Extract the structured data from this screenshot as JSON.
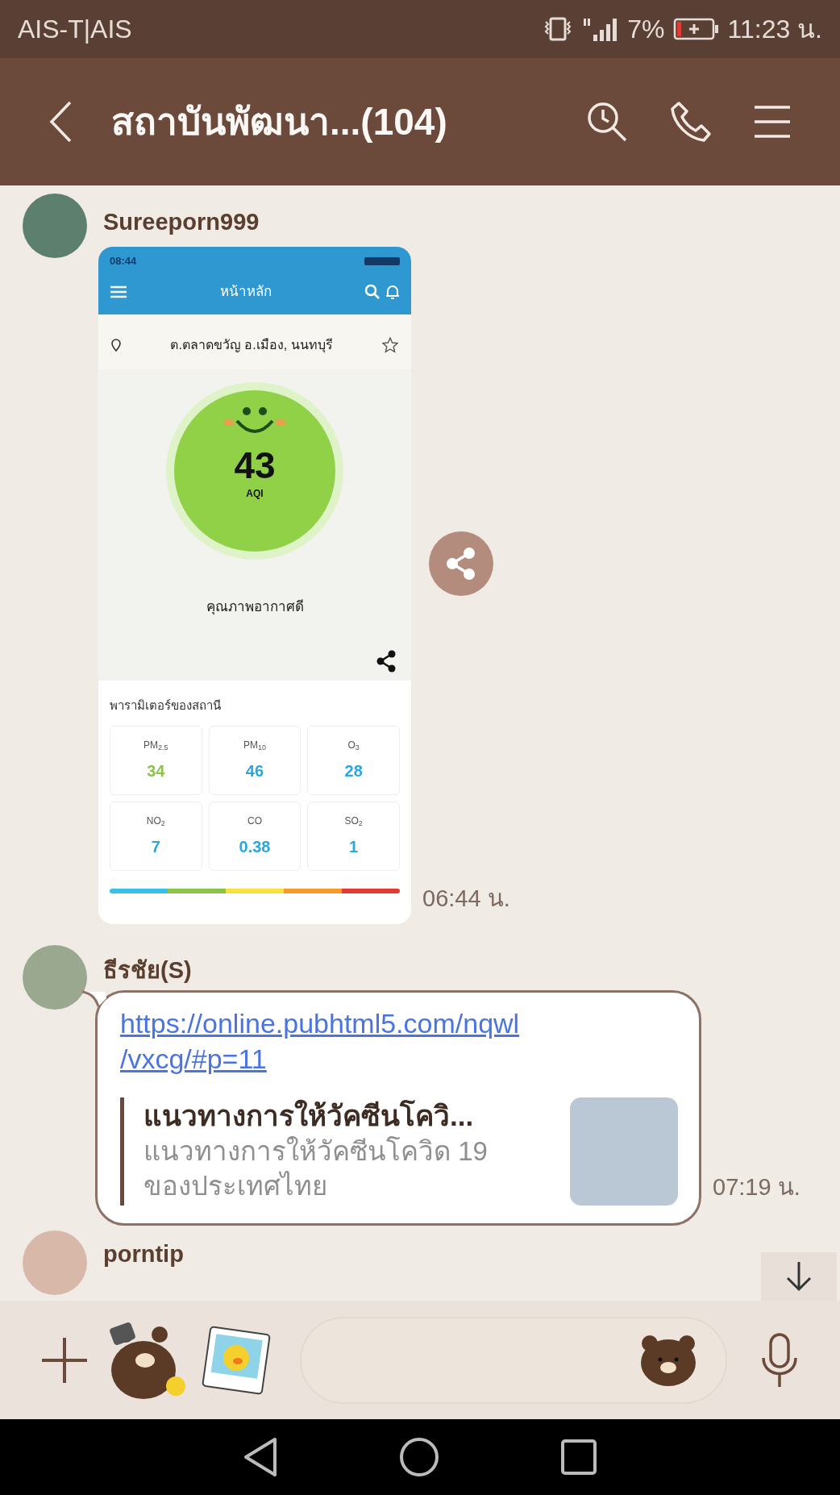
{
  "status_bar": {
    "carrier": "AIS-T|AIS",
    "battery_percent": "7%",
    "time": "11:23 น."
  },
  "header": {
    "title": "สถาบันพัฒนา...(104)"
  },
  "messages": [
    {
      "kind": "image",
      "sender": "Sureeporn999",
      "time": "06:44 น.",
      "shot": {
        "time": "08:44",
        "title": "หน้าหลัก",
        "location": "ต.ตลาดขวัญ อ.เมือง, นนทบุรี",
        "aqi": "43",
        "aqi_label": "AQI",
        "quality": "คุณภาพอากาศดี",
        "section_title": "พารามิเตอร์ของสถานี",
        "params": [
          {
            "name": "PM$_{2.5}$",
            "value": "34",
            "color": "#8bc34a"
          },
          {
            "name": "PM$_{10}$",
            "value": "46",
            "color": "#29a8e0"
          },
          {
            "name": "O$_{3}$",
            "value": "28",
            "color": "#29a8e0"
          },
          {
            "name": "NO$_{2}$",
            "value": "7",
            "color": "#29a8e0"
          },
          {
            "name": "CO",
            "value": "0.38",
            "color": "#29a8e0"
          },
          {
            "name": "SO$_{2}$",
            "value": "1",
            "color": "#29a8e0"
          }
        ]
      }
    },
    {
      "kind": "link",
      "sender": "ธีรชัย(S)",
      "time": "07:19 น.",
      "url": "https://online.pubhtml5.com/nqwl/vxcg/#p=11",
      "preview": {
        "title": "แนวทางการให้วัคซีนโควิ...",
        "description": "แนวทางการให้วัคซีนโควิด 19 ของประเทศไทย"
      }
    },
    {
      "kind": "partial",
      "sender": "porntip"
    }
  ]
}
